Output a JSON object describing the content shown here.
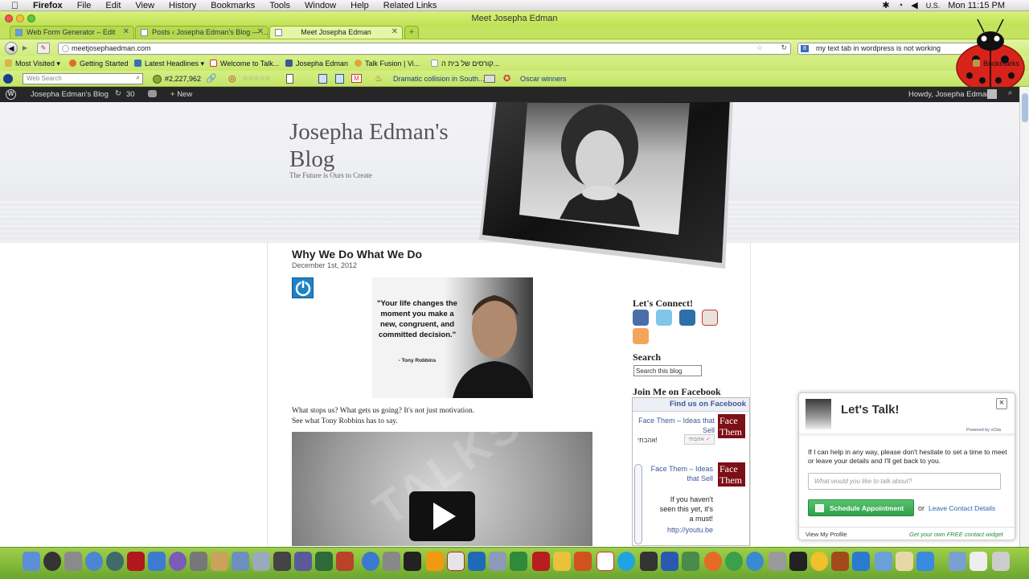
{
  "menubar": {
    "app": "Firefox",
    "items": [
      "File",
      "Edit",
      "View",
      "History",
      "Bookmarks",
      "Tools",
      "Window",
      "Help",
      "Related Links"
    ],
    "input_lang": "U.S.",
    "clock": "Mon 11:15 PM"
  },
  "window": {
    "title": "Meet Josepha Edman"
  },
  "tabs": [
    {
      "label": "Web Form Generator – Edit"
    },
    {
      "label": "Posts ‹ Josepha Edman's Blog — …"
    },
    {
      "label": "Meet Josepha Edman"
    }
  ],
  "nav": {
    "url": "meetjosephaedman.com",
    "search_query": "my text tab in wordpress is not working"
  },
  "bookmarks": {
    "items": [
      "Most Visited",
      "Getting Started",
      "Latest Headlines",
      "Welcome to Talk...",
      "Josepha Edman",
      "Talk Fusion | Vi...",
      "קורסים של בית ה..."
    ],
    "right_label": "Bookmarks"
  },
  "toolbar": {
    "search_placeholder": "Web Search",
    "count": "#2,227,962",
    "news1": "Dramatic collision in South...",
    "news2": "Oscar winners"
  },
  "wpbar": {
    "site": "Josepha Edman's Blog",
    "updates": "30",
    "new_label": "New",
    "howdy": "Howdy, Josepha Edman"
  },
  "blog": {
    "title": "Josepha Edman's Blog",
    "tagline": "The Future is Ours to Create"
  },
  "post": {
    "title": "Why We Do What We Do",
    "date": "December 1st, 2012",
    "quote": "\"Your life changes the moment you make a new, congruent, and committed decision.\"",
    "quote_author": "- Tony Robbins",
    "line1": "What stops us? What gets us going? It's not just motivation.",
    "line2": "See what Tony Robbins has to say.",
    "video_watermark": "TALKS"
  },
  "sidebar": {
    "connect_heading": "Let's Connect!",
    "search_heading": "Search",
    "search_placeholder": "Search this blog",
    "facebook_heading": "Join Me on Facebook",
    "fb_box_title": "Find us on Facebook",
    "fb_page1": "Face Them – Ideas that Sell",
    "fb_like": "אהבתי!",
    "fb_like_btn": "אהבתי",
    "fb_page2": "Face Them – Ideas that Sell",
    "fb_post_text": "If you haven't seen this yet, it's a must!",
    "fb_post_link": "http://youtu.be",
    "fb_thumb_text": "Face Them"
  },
  "vcita": {
    "heading": "Let's Talk!",
    "close": "×",
    "powered": "Powered by vCita",
    "message": "If I can help in any way, please don't hesitate to set a time to meet or leave your details and I'll get back to you.",
    "placeholder": "What would you like to talk about?",
    "schedule_btn": "Schedule Appointment",
    "or": "or",
    "leave_link": "Leave Contact Details",
    "profile_link": "View My Profile",
    "free_widget": "Get your own FREE contact widget"
  },
  "colors": {
    "firefox_theme": "#c3e35e",
    "wp_bar": "#262626",
    "facebook": "#3b5998",
    "vcita_green": "#3cb371",
    "power_blue": "#1d82c6"
  }
}
